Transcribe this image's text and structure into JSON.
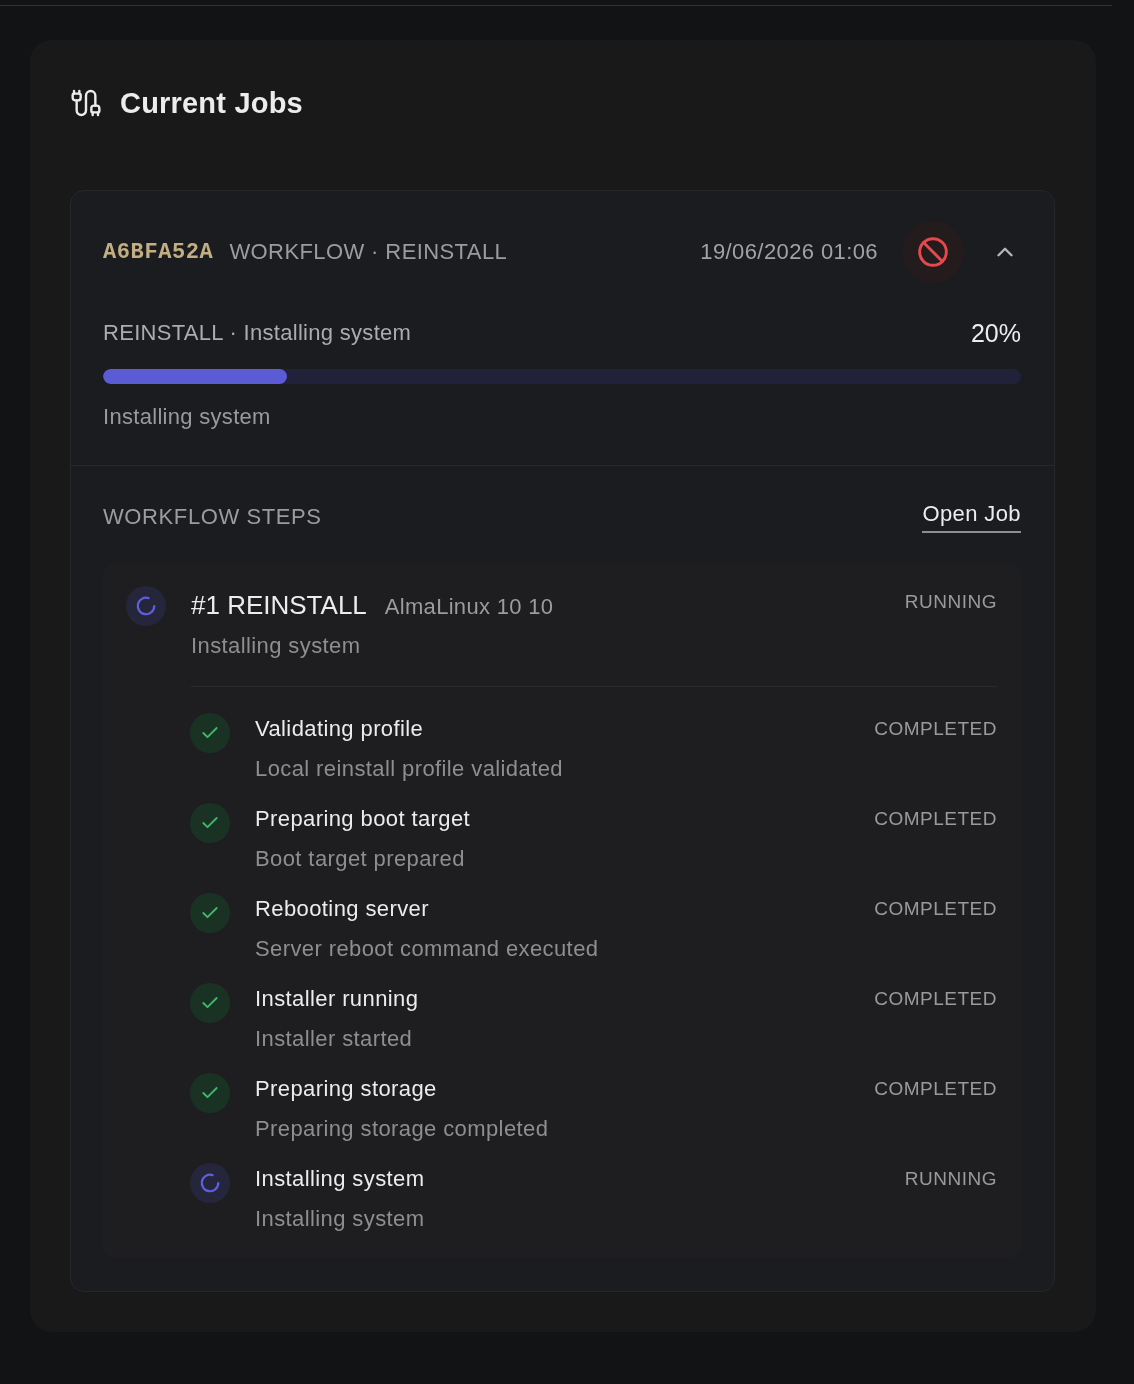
{
  "title": "Current Jobs",
  "job": {
    "id": "A6BFA52A",
    "type": "WORKFLOW · REINSTALL",
    "date": "19/06/2026 01:06",
    "expanded": true,
    "progress": {
      "label": "REINSTALL · Installing system",
      "percent": "20%",
      "level": 0.2,
      "message": "Installing system"
    },
    "steps_heading": "WORKFLOW STEPS",
    "open_link": "Open Job",
    "step": {
      "title": "#1 REINSTALL",
      "detail": "AlmaLinux 10 10",
      "kind": "running",
      "status": "RUNNING",
      "message": "Installing system",
      "substeps": [
        {
          "title": "Validating profile",
          "message": "Local reinstall profile validated",
          "kind": "completed",
          "status": "COMPLETED"
        },
        {
          "title": "Preparing boot target",
          "message": "Boot target prepared",
          "kind": "completed",
          "status": "COMPLETED"
        },
        {
          "title": "Rebooting server",
          "message": "Server reboot command executed",
          "kind": "completed",
          "status": "COMPLETED"
        },
        {
          "title": "Installer running",
          "message": "Installer started",
          "kind": "completed",
          "status": "COMPLETED"
        },
        {
          "title": "Preparing storage",
          "message": "Preparing storage completed",
          "kind": "completed",
          "status": "COMPLETED"
        },
        {
          "title": "Installing system",
          "message": "Installing system",
          "kind": "running",
          "status": "RUNNING"
        }
      ]
    }
  }
}
